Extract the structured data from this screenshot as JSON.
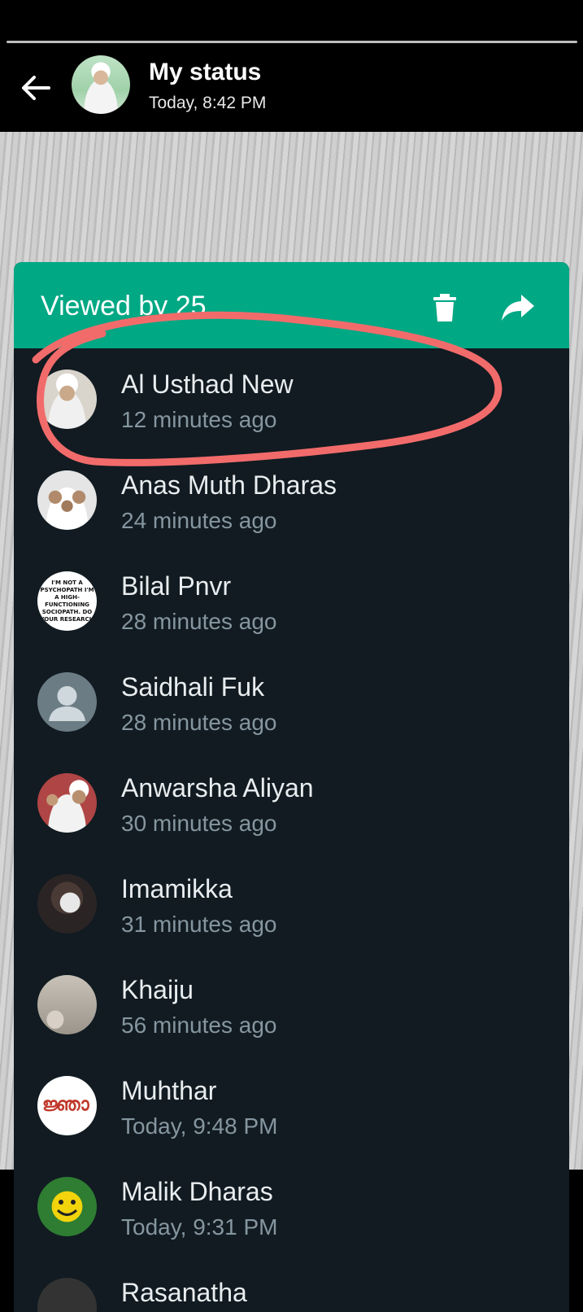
{
  "header": {
    "title": "My status",
    "time": "Today, 8:42 PM"
  },
  "panel": {
    "viewed_by": "Viewed by 25",
    "viewers": [
      {
        "name": "Al Usthad New",
        "time": "12 minutes ago"
      },
      {
        "name": "Anas Muth Dharas",
        "time": "24 minutes ago"
      },
      {
        "name": "Bilal Pnvr",
        "time": "28 minutes ago"
      },
      {
        "name": "Saidhali Fuk",
        "time": "28 minutes ago"
      },
      {
        "name": "Anwarsha Aliyan",
        "time": "30 minutes ago"
      },
      {
        "name": "Imamikka",
        "time": "31 minutes ago"
      },
      {
        "name": "Khaiju",
        "time": "56 minutes ago"
      },
      {
        "name": "Muhthar",
        "time": "Today, 9:48 PM"
      },
      {
        "name": "Malik  Dharas",
        "time": "Today, 9:31 PM"
      },
      {
        "name": "Rasanatha",
        "time": ""
      }
    ],
    "avatar_text": {
      "bilal": "I'M NOT A PSYCHOPATH I'M A HIGH- FUNCTIONING SOCIOPATH. DO YOUR RESEARCH",
      "muhthar": "ജ്ഞാ"
    }
  },
  "colors": {
    "accent": "#00a884",
    "panel_bg": "#111b21",
    "name_text": "#e9edef",
    "time_text": "#8696a0",
    "marker": "#f26b6b"
  },
  "icons": [
    "back-arrow-icon",
    "trash-icon",
    "share-icon",
    "default-avatar-icon"
  ]
}
